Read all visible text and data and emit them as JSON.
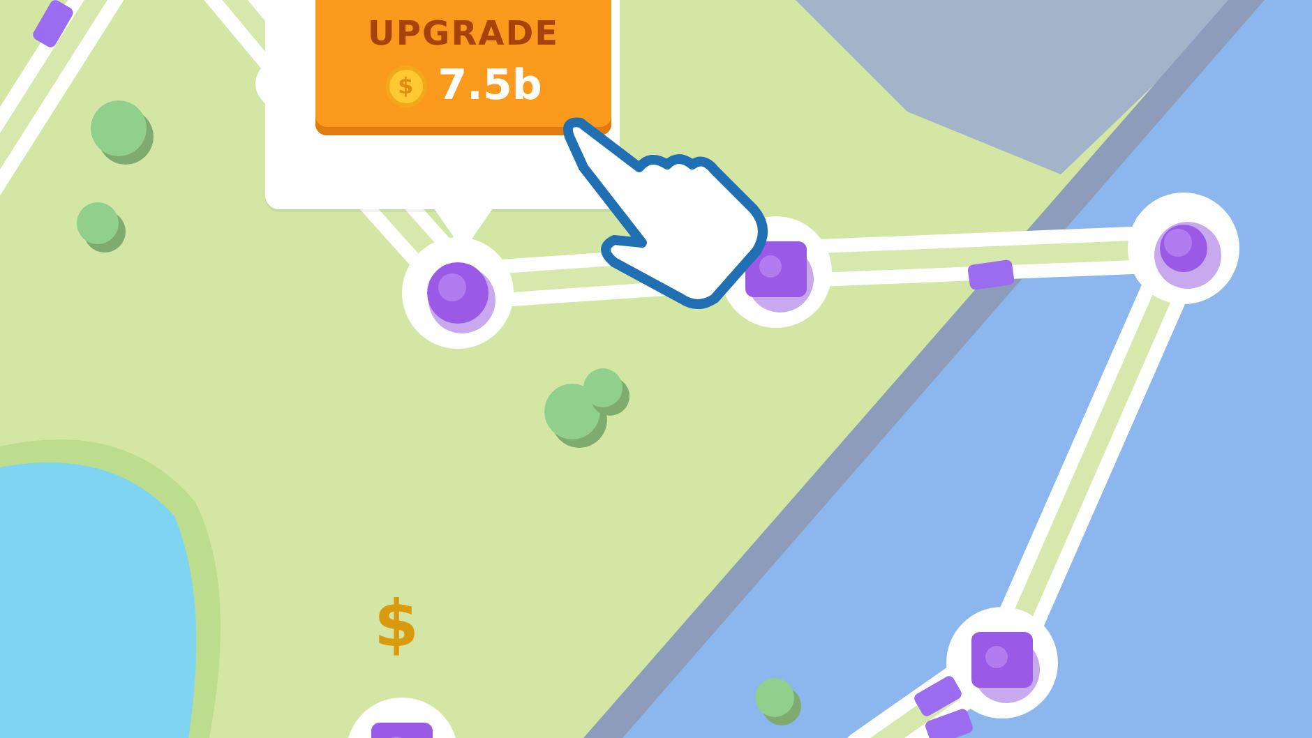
{
  "upgrade_popup": {
    "label": "UPGRADE",
    "coin_symbol": "$",
    "price": "7.5b"
  },
  "floating_reward": {
    "symbol": "$"
  }
}
